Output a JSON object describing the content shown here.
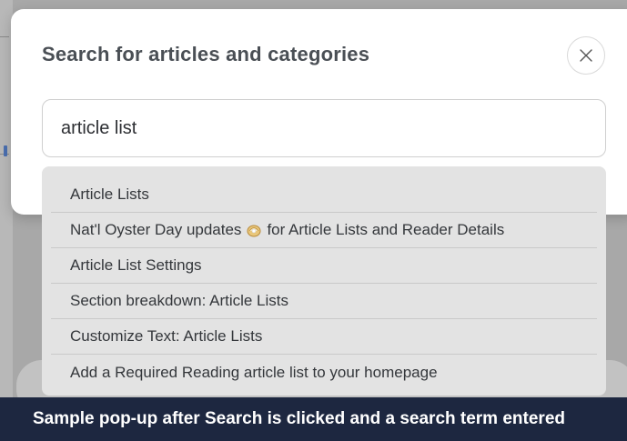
{
  "modal": {
    "title": "Search for articles and categories",
    "close_icon": "close-icon"
  },
  "search": {
    "value": "article list"
  },
  "results": [
    {
      "label": "Article Lists"
    },
    {
      "label_before": "Nat'l Oyster Day updates",
      "icon": "oyster-icon",
      "label_after": "for Article Lists and Reader Details"
    },
    {
      "label": "Article List Settings"
    },
    {
      "label": "Section breakdown: Article Lists"
    },
    {
      "label": "Customize Text: Article Lists"
    },
    {
      "label": "Add a Required Reading article list to your homepage"
    }
  ],
  "caption": {
    "text": "Sample pop-up after Search is clicked and a search term entered"
  },
  "colors": {
    "caption_bg": "#1d2740",
    "results_bg": "#e3e3e3",
    "title": "#4a4f55"
  }
}
